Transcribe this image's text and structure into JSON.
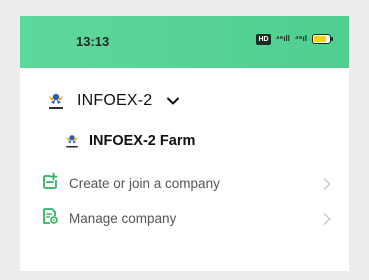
{
  "status_bar": {
    "time": "13:13",
    "hd_badge": "HD",
    "signal_1": "⁴⁶ıll",
    "signal_2": "⁴⁶ıl",
    "colors": {
      "background": "#5fd79b",
      "battery_fill": "#f2d400"
    }
  },
  "company": {
    "name": "INFOEX-2",
    "farm_name": "INFOEX-2 Farm"
  },
  "menu": {
    "items": [
      {
        "label": "Create or join a company",
        "icon": "create-company-icon"
      },
      {
        "label": "Manage company",
        "icon": "manage-company-icon"
      }
    ]
  },
  "accent_color": "#2fb35e"
}
